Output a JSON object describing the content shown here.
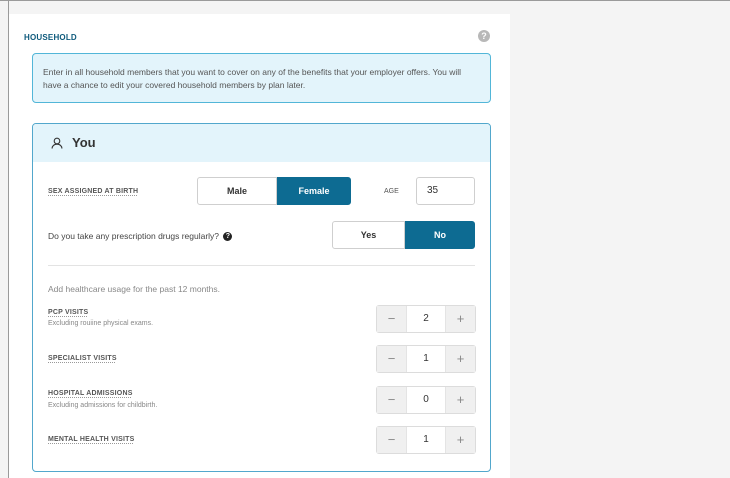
{
  "household": {
    "title": "HOUSEHOLD",
    "help_icon": "question-circle-icon",
    "help_glyph": "?",
    "info": "Enter in all household members that you want to cover on any of the benefits that your employer offers. You will have a chance to edit your covered household members by plan later."
  },
  "member": {
    "icon": "user-icon",
    "name": "You",
    "sex_label": "SEX ASSIGNED AT BIRTH",
    "sex_options": [
      "Male",
      "Female"
    ],
    "sex_selected": "Female",
    "age_label": "AGE",
    "age_value": "35",
    "rx_question": "Do you take any prescription drugs regularly?",
    "rx_help_glyph": "?",
    "rx_options": [
      "Yes",
      "No"
    ],
    "rx_selected": "No",
    "usage_intro": "Add healthcare usage for the past 12 months.",
    "usage": [
      {
        "label": "PCP VISITS",
        "sub": "Excluding rouiine physical exams.",
        "value": "2"
      },
      {
        "label": "SPECIALIST VISITS",
        "sub": "",
        "value": "1"
      },
      {
        "label": "HOSPITAL ADMISSIONS",
        "sub": "Excluding admissions for childbirth.",
        "value": "0"
      },
      {
        "label": "MENTAL HEALTH VISITS",
        "sub": "",
        "value": "1"
      }
    ],
    "minus_glyph": "−",
    "plus_glyph": "+"
  },
  "colors": {
    "accent": "#0d6b92",
    "info_bg": "#e3f4fb",
    "info_border": "#52b6d8"
  }
}
